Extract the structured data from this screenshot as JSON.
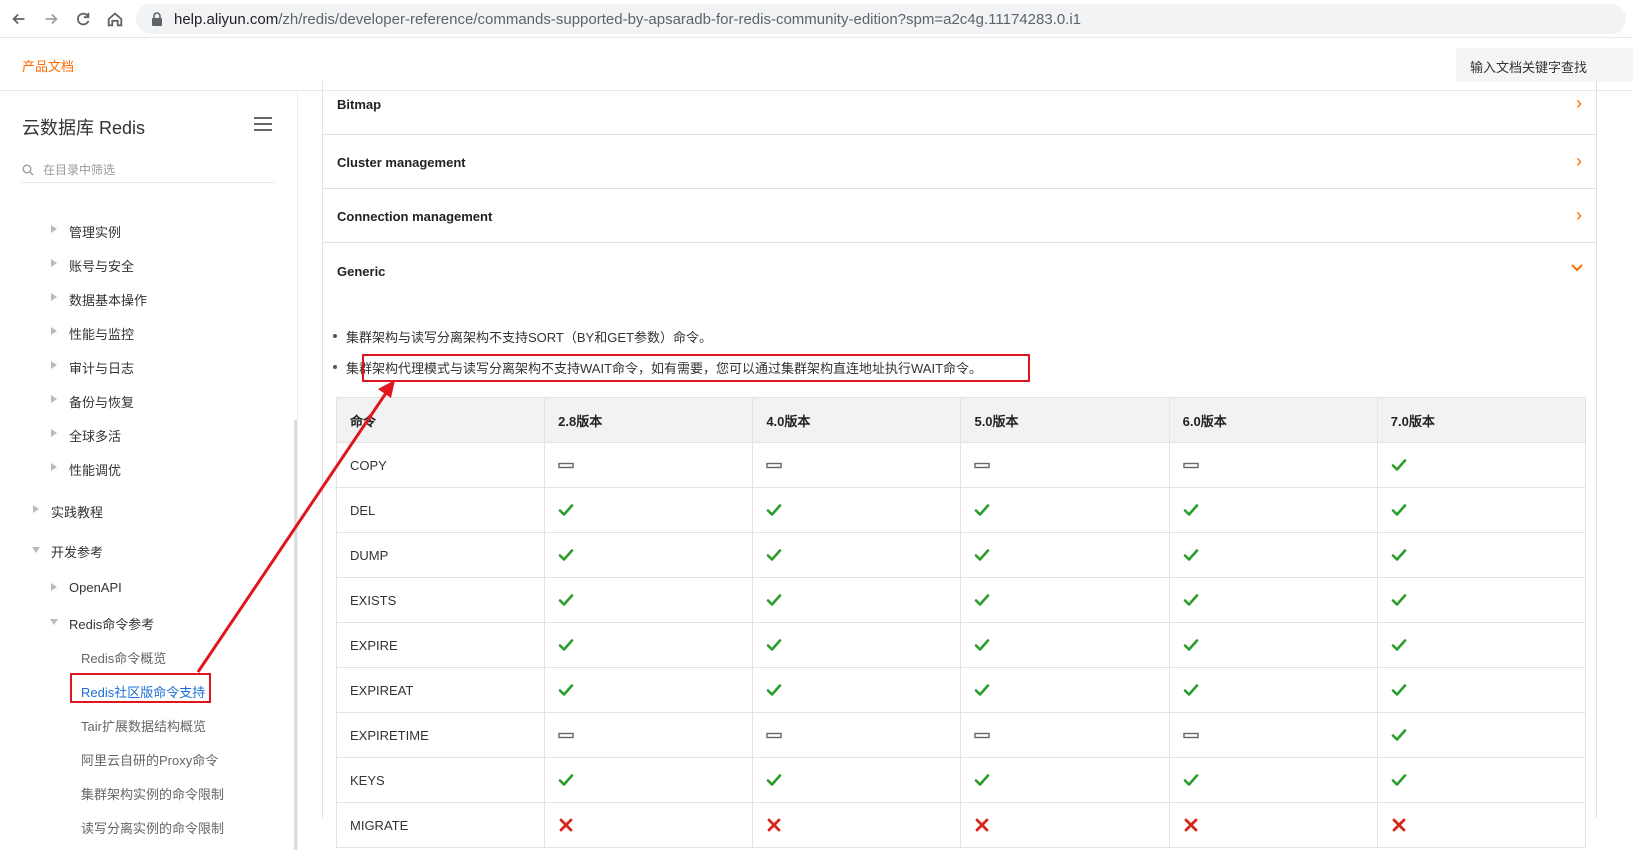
{
  "browser": {
    "url_host": "help.aliyun.com",
    "url_path": "/zh/redis/developer-reference/commands-supported-by-apsaradb-for-redis-community-edition?spm=a2c4g.11174283.0.i1"
  },
  "header": {
    "product_docs": "产品文档",
    "search_placeholder": "输入文档关键字查找"
  },
  "sidebar": {
    "title": "云数据库 Redis",
    "filter_placeholder": "在目录中筛选",
    "items": [
      {
        "label": "管理实例"
      },
      {
        "label": "账号与安全"
      },
      {
        "label": "数据基本操作"
      },
      {
        "label": "性能与监控"
      },
      {
        "label": "审计与日志"
      },
      {
        "label": "备份与恢复"
      },
      {
        "label": "全球多活"
      },
      {
        "label": "性能调优"
      },
      {
        "label": "实践教程"
      },
      {
        "label": "开发参考"
      },
      {
        "label": "OpenAPI"
      },
      {
        "label": "Redis命令参考"
      },
      {
        "label": "Redis命令概览"
      },
      {
        "label": "Redis社区版命令支持"
      },
      {
        "label": "Tair扩展数据结构概览"
      },
      {
        "label": "阿里云自研的Proxy命令"
      },
      {
        "label": "集群架构实例的命令限制"
      },
      {
        "label": "读写分离实例的命令限制"
      }
    ]
  },
  "main": {
    "sections": [
      {
        "label": "Bitmap"
      },
      {
        "label": "Cluster management"
      },
      {
        "label": "Connection management"
      },
      {
        "label": "Generic"
      }
    ],
    "notes": [
      "集群架构与读写分离架构不支持SORT（BY和GET参数）命令。",
      "集群架构代理模式与读写分离架构不支持WAIT命令，如有需要，您可以通过集群架构直连地址执行WAIT命令。"
    ],
    "table": {
      "headers": [
        "命令",
        "2.8版本",
        "4.0版本",
        "5.0版本",
        "6.0版本",
        "7.0版本"
      ],
      "rows": [
        {
          "command": "COPY",
          "support": [
            "none",
            "none",
            "none",
            "none",
            "yes"
          ]
        },
        {
          "command": "DEL",
          "support": [
            "yes",
            "yes",
            "yes",
            "yes",
            "yes"
          ]
        },
        {
          "command": "DUMP",
          "support": [
            "yes",
            "yes",
            "yes",
            "yes",
            "yes"
          ]
        },
        {
          "command": "EXISTS",
          "support": [
            "yes",
            "yes",
            "yes",
            "yes",
            "yes"
          ]
        },
        {
          "command": "EXPIRE",
          "support": [
            "yes",
            "yes",
            "yes",
            "yes",
            "yes"
          ]
        },
        {
          "command": "EXPIREAT",
          "support": [
            "yes",
            "yes",
            "yes",
            "yes",
            "yes"
          ]
        },
        {
          "command": "EXPIRETIME",
          "support": [
            "none",
            "none",
            "none",
            "none",
            "yes"
          ]
        },
        {
          "command": "KEYS",
          "support": [
            "yes",
            "yes",
            "yes",
            "yes",
            "yes"
          ]
        },
        {
          "command": "MIGRATE",
          "support": [
            "no",
            "no",
            "no",
            "no",
            "no"
          ]
        }
      ]
    }
  },
  "colors": {
    "accent": "#ff6a00",
    "active_link": "#1a6fd6",
    "annotation_red": "#e0161e",
    "check_green": "#2a9d2a",
    "cross_red": "#d9261c"
  },
  "icons": {
    "supported": "check-icon",
    "not_supported": "cross-icon",
    "not_applicable": "dash-icon"
  }
}
